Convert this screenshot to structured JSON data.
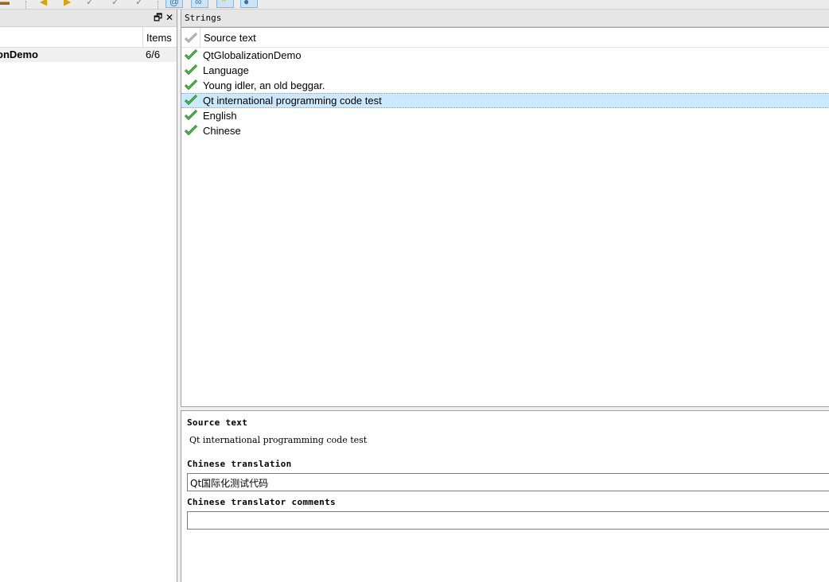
{
  "toolbar": {
    "icons": [
      "book-icon",
      "prev-icon",
      "next-icon",
      "prev-unfinished-icon",
      "next-unfinished-icon",
      "done-and-next-icon",
      "accelerators-icon",
      "phrases-icon",
      "placeholders-icon",
      "punctuation-icon"
    ]
  },
  "context_pane": {
    "header_items": "Items",
    "rows": [
      {
        "name": "onDemo",
        "count": "6/6"
      }
    ]
  },
  "strings_pane": {
    "title": "Strings",
    "header": "Source text",
    "rows": [
      {
        "text": "QtGlobalizationDemo",
        "status": "done"
      },
      {
        "text": "Language",
        "status": "done"
      },
      {
        "text": "Young idler, an old beggar.",
        "status": "done"
      },
      {
        "text": "Qt international programming code test",
        "status": "done",
        "selected": true
      },
      {
        "text": "English",
        "status": "done"
      },
      {
        "text": "Chinese",
        "status": "done"
      }
    ]
  },
  "editor": {
    "source_label": "Source text",
    "source_value": "Qt international programming code test",
    "translation_label": "Chinese translation",
    "translation_value": "Qt国际化测试代码",
    "comments_label": "Chinese translator comments",
    "comments_value": ""
  },
  "colors": {
    "check_green": "#1e9e1e",
    "selection": "#cce8ff"
  }
}
